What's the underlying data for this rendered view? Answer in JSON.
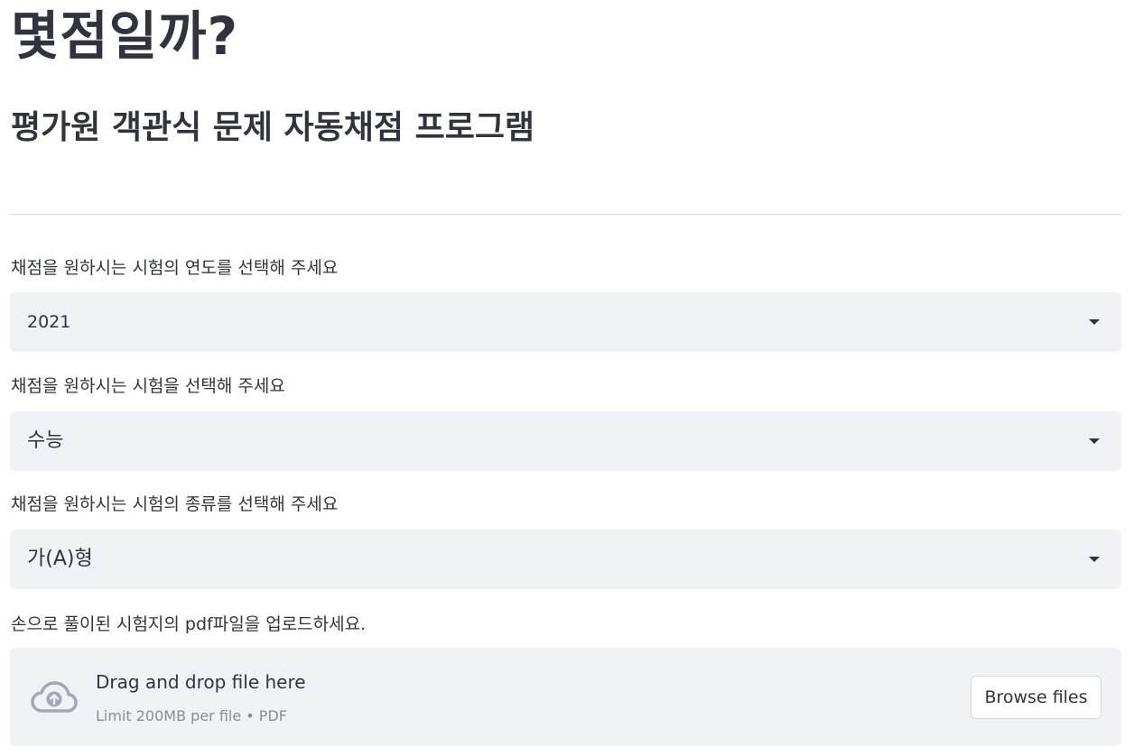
{
  "header": {
    "title": "몇점일까?",
    "subtitle": "평가원 객관식 문제 자동채점 프로그램"
  },
  "form": {
    "year": {
      "label": "채점을 원하시는 시험의 연도를 선택해 주세요",
      "value": "2021"
    },
    "exam": {
      "label": "채점을 원하시는 시험을 선택해 주세요",
      "value": "수능"
    },
    "type": {
      "label": "채점을 원하시는 시험의 종류를 선택해 주세요",
      "value": "가(A)형"
    },
    "upload": {
      "label": "손으로 풀이된 시험지의 pdf파일을 업로드하세요.",
      "drag_text": "Drag and drop file here",
      "limit_text": "Limit 200MB per file • PDF",
      "browse_label": "Browse files",
      "icon": "cloud-upload-icon"
    }
  },
  "colors": {
    "text": "#31333f",
    "input_bg": "#f0f2f6",
    "muted": "#8a8d96",
    "divider": "#d9d9dd"
  }
}
